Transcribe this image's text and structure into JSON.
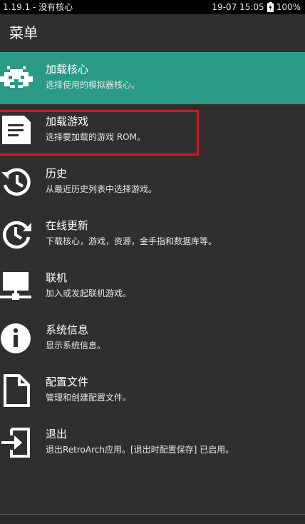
{
  "status_bar": {
    "left_text": "1.19.1 - 没有核心",
    "right_time": "19-07 15:05",
    "battery": "100%",
    "battery_icon": "battery-charging-icon"
  },
  "header": {
    "title": "菜单"
  },
  "menu": {
    "items": [
      {
        "label": "加载核心",
        "sublabel": "选择使用的模拟器核心。",
        "icon": "retroarch-invader-icon",
        "selected": true
      },
      {
        "label": "加载游戏",
        "sublabel": "选择要加载的游戏 ROM。",
        "icon": "document-icon",
        "highlighted": true
      },
      {
        "label": "历史",
        "sublabel": "从最近历史列表中选择游戏。",
        "icon": "history-icon"
      },
      {
        "label": "在线更新",
        "sublabel": "下载核心，游戏，资源，金手指和数据库等。",
        "icon": "update-icon"
      },
      {
        "label": "联机",
        "sublabel": "加入或发起联机游戏。",
        "icon": "netplay-icon"
      },
      {
        "label": "系统信息",
        "sublabel": "显示系统信息。",
        "icon": "info-icon"
      },
      {
        "label": "配置文件",
        "sublabel": "管理和创建配置文件。",
        "icon": "file-icon"
      },
      {
        "label": "退出",
        "sublabel": "退出RetroArch应用。[退出时配置保存] 已启用。",
        "icon": "exit-icon"
      }
    ]
  },
  "colors": {
    "selected_background": "#2a9a84",
    "highlight_border": "#d9141c",
    "background": "#2f2f2f"
  }
}
